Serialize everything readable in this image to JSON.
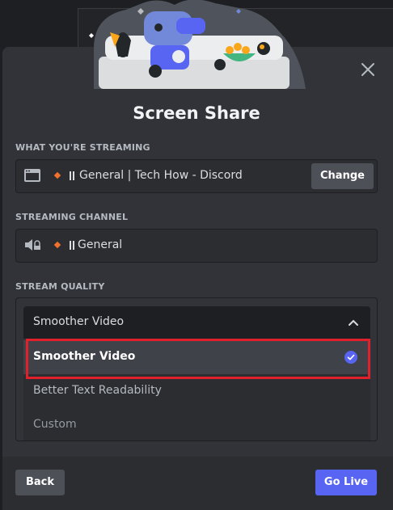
{
  "modal": {
    "title": "Screen Share",
    "close_icon": "close-icon"
  },
  "streaming": {
    "label": "WHAT YOU'RE STREAMING",
    "source": "General | Tech How - Discord",
    "change_label": "Change",
    "icon": "window-icon"
  },
  "channel": {
    "label": "STREAMING CHANNEL",
    "name": "General",
    "icon": "speaker-icon"
  },
  "quality": {
    "label": "STREAM QUALITY",
    "selected": "Smoother Video",
    "options": [
      {
        "label": "Smoother Video",
        "selected": true
      },
      {
        "label": "Better Text Readability",
        "selected": false
      },
      {
        "label": "Custom",
        "selected": false
      }
    ]
  },
  "footer": {
    "back_label": "Back",
    "go_live_label": "Go Live"
  },
  "colors": {
    "accent": "#5865f2",
    "highlight": "#e0202b",
    "server_dot": "#f0712c"
  }
}
